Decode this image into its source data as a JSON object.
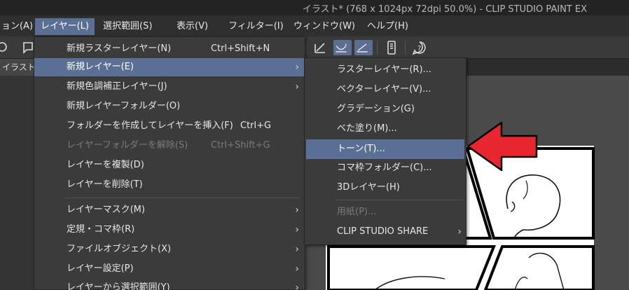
{
  "window": {
    "title": "イラスト* (768 x 1024px 72dpi 50.0%)  - CLIP STUDIO PAINT EX"
  },
  "menubar": {
    "items": [
      {
        "label": "ョン(A)",
        "active": false
      },
      {
        "label": "レイヤー(L)",
        "active": true
      },
      {
        "label": "選択範囲(S)",
        "active": false
      },
      {
        "label": "表示(V)",
        "active": false
      },
      {
        "label": "フィルター(I)",
        "active": false
      },
      {
        "label": "ウィンドウ(W)",
        "active": false
      },
      {
        "label": "ヘルプ(H)",
        "active": false
      }
    ]
  },
  "doc_tab": {
    "label": "イラスト*"
  },
  "layer_menu": {
    "items": [
      {
        "label": "新規ラスターレイヤー(N)",
        "shortcut": "Ctrl+Shift+N",
        "submenu": false,
        "disabled": false,
        "highlight": false
      },
      {
        "label": "新規レイヤー(E)",
        "shortcut": "",
        "submenu": true,
        "disabled": false,
        "highlight": true
      },
      {
        "label": "新規色調補正レイヤー(J)",
        "shortcut": "",
        "submenu": true,
        "disabled": false,
        "highlight": false
      },
      {
        "label": "新規レイヤーフォルダー(O)",
        "shortcut": "",
        "submenu": false,
        "disabled": false,
        "highlight": false
      },
      {
        "label": "フォルダーを作成してレイヤーを挿入(F)",
        "shortcut": "Ctrl+G",
        "submenu": false,
        "disabled": false,
        "highlight": false
      },
      {
        "label": "レイヤーフォルダーを解除(S)",
        "shortcut": "Ctrl+Shift+G",
        "submenu": false,
        "disabled": true,
        "highlight": false
      },
      {
        "label": "レイヤーを複製(D)",
        "shortcut": "",
        "submenu": false,
        "disabled": false,
        "highlight": false
      },
      {
        "label": "レイヤーを削除(T)",
        "shortcut": "",
        "submenu": false,
        "disabled": false,
        "highlight": false
      },
      {
        "label": "レイヤーマスク(M)",
        "shortcut": "",
        "submenu": true,
        "disabled": false,
        "highlight": false
      },
      {
        "label": "定規・コマ枠(R)",
        "shortcut": "",
        "submenu": true,
        "disabled": false,
        "highlight": false
      },
      {
        "label": "ファイルオブジェクト(X)",
        "shortcut": "",
        "submenu": true,
        "disabled": false,
        "highlight": false
      },
      {
        "label": "レイヤー設定(P)",
        "shortcut": "",
        "submenu": true,
        "disabled": false,
        "highlight": false
      },
      {
        "label": "レイヤーから選択範囲(Y)",
        "shortcut": "",
        "submenu": true,
        "disabled": false,
        "highlight": false
      }
    ]
  },
  "new_layer_submenu": {
    "items": [
      {
        "label": "ラスターレイヤー(R)...",
        "submenu": false,
        "disabled": false,
        "highlight": false
      },
      {
        "label": "ベクターレイヤー(V)...",
        "submenu": false,
        "disabled": false,
        "highlight": false
      },
      {
        "label": "グラデーション(G)",
        "submenu": false,
        "disabled": false,
        "highlight": false
      },
      {
        "label": "べた塗り(M)...",
        "submenu": false,
        "disabled": false,
        "highlight": false
      },
      {
        "label": "トーン(T)...",
        "submenu": false,
        "disabled": false,
        "highlight": true
      },
      {
        "label": "コマ枠フォルダー(C)...",
        "submenu": false,
        "disabled": false,
        "highlight": false
      },
      {
        "label": "3Dレイヤー(H)",
        "submenu": false,
        "disabled": false,
        "highlight": false
      },
      {
        "label": "用紙(P)...",
        "submenu": false,
        "disabled": true,
        "highlight": false
      },
      {
        "label": "CLIP STUDIO SHARE",
        "submenu": true,
        "disabled": false,
        "highlight": false
      }
    ]
  },
  "colors": {
    "menu_highlight": "#5b6f95",
    "menu_bg": "#3b3b3b",
    "annotation_arrow": "#e8262f"
  }
}
